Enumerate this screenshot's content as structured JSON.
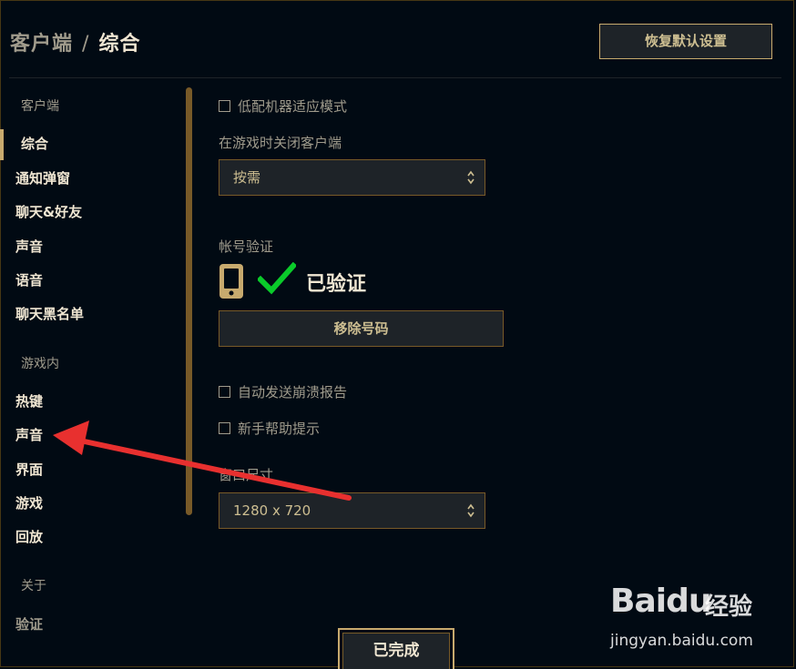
{
  "header": {
    "parent": "客户端",
    "separator": "/",
    "current": "综合",
    "restore_button": "恢复默认设置"
  },
  "sidebar": {
    "section_client": "客户端",
    "client_items": [
      "综合",
      "通知弹窗",
      "聊天&好友",
      "声音",
      "语音",
      "聊天黑名单"
    ],
    "active_item": "综合",
    "section_ingame": "游戏内",
    "ingame_items": [
      "热键",
      "声音",
      "界面",
      "游戏",
      "回放"
    ],
    "section_about": "关于",
    "about_items": [
      "验证"
    ]
  },
  "settings": {
    "low_spec_mode": {
      "label": "低配机器适应模式",
      "checked": false
    },
    "close_client_label": "在游戏时关闭客户端",
    "close_client_value": "按需",
    "account_verify_label": "帐号验证",
    "verified_text": "已验证",
    "remove_number_button": "移除号码",
    "auto_crash_report": {
      "label": "自动发送崩溃报告",
      "checked": false
    },
    "newbie_tips": {
      "label": "新手帮助提示",
      "checked": false
    },
    "window_size_label": "窗口尺寸",
    "window_size_value": "1280 x 720"
  },
  "footer": {
    "done_button": "已完成"
  },
  "watermark": {
    "logo": "Baidu",
    "cn": "经验",
    "url": "jingyan.baidu.com"
  },
  "colors": {
    "background": "#010a13",
    "gold": "#c8aa6e",
    "gold_dark": "#785a28",
    "text_light": "#f0e6d2",
    "text_muted": "#a09b8c",
    "check_green": "#0acb2a",
    "annotation_red": "#e8302f"
  },
  "icons": {
    "phone": "phone-icon",
    "check": "checkmark-icon",
    "select_arrows": "up-down-chevron-icon",
    "annotation": "red-arrow-icon"
  }
}
